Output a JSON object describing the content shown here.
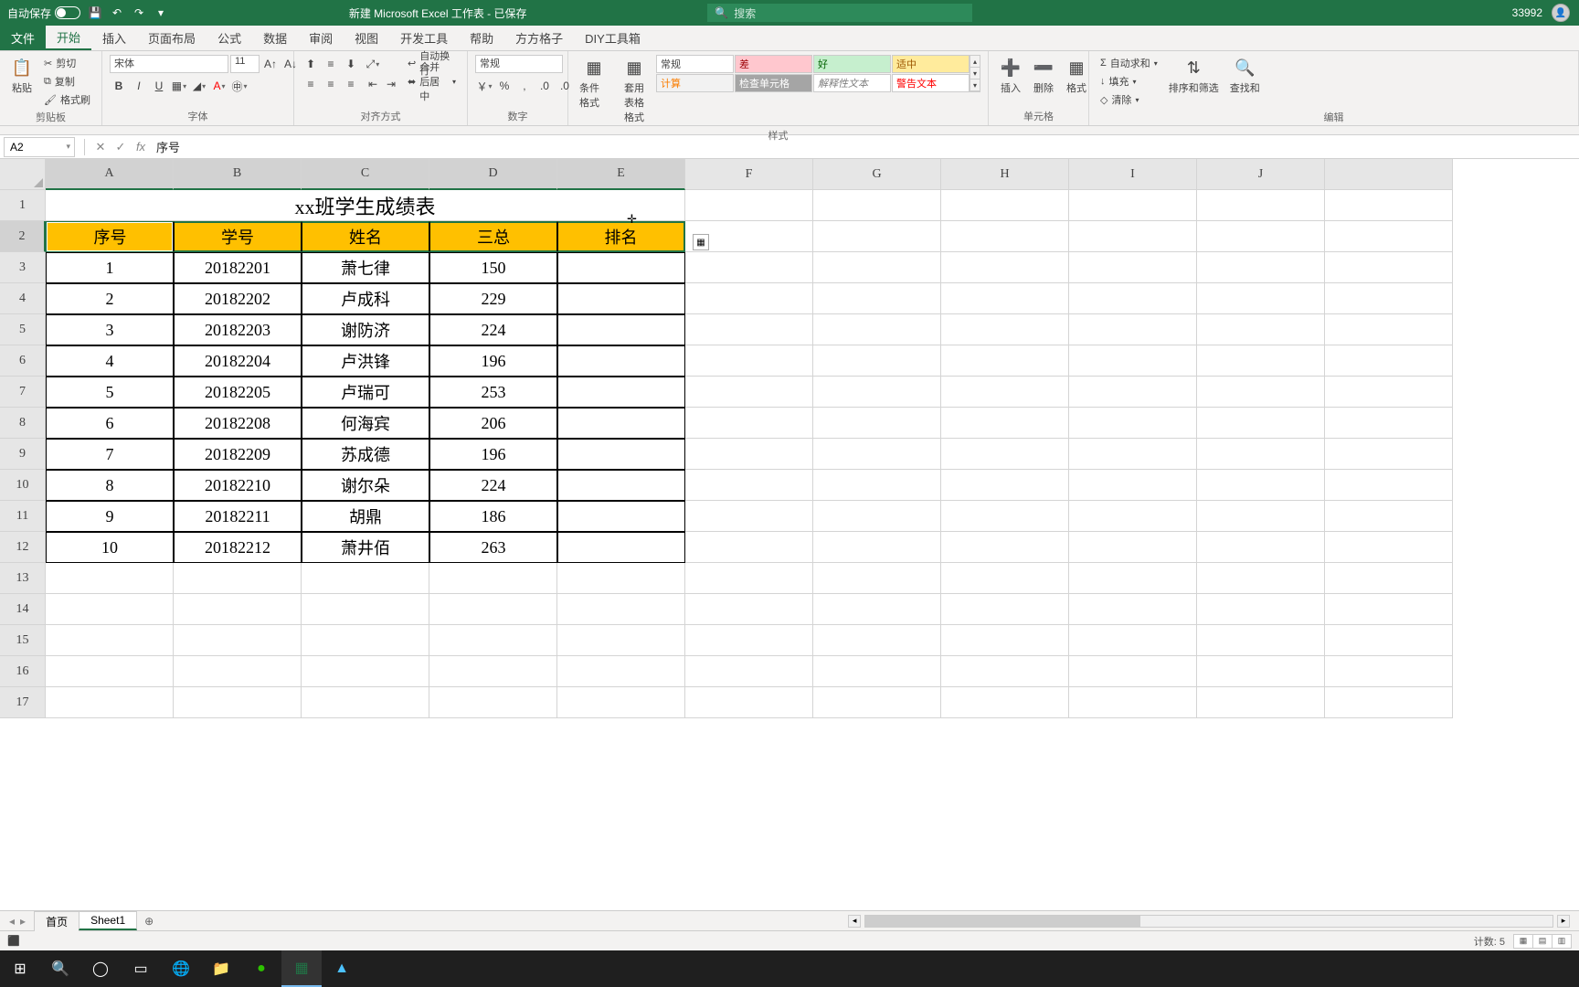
{
  "titlebar": {
    "autosave_label": "自动保存",
    "doc_title": "新建 Microsoft Excel 工作表 - 已保存",
    "search_placeholder": "搜索",
    "username": "33992"
  },
  "tabs": {
    "file": "文件",
    "home": "开始",
    "insert": "插入",
    "pagelayout": "页面布局",
    "formulas": "公式",
    "data": "数据",
    "review": "审阅",
    "view": "视图",
    "developer": "开发工具",
    "help": "帮助",
    "fangfang": "方方格子",
    "diy": "DIY工具箱"
  },
  "ribbon": {
    "clipboard": {
      "paste": "粘贴",
      "cut": "剪切",
      "copy": "复制",
      "format_painter": "格式刷",
      "label": "剪贴板"
    },
    "font": {
      "name": "宋体",
      "size": "11",
      "label": "字体"
    },
    "alignment": {
      "wrap": "自动换行",
      "merge": "合并后居中",
      "label": "对齐方式"
    },
    "number": {
      "format": "常规",
      "label": "数字"
    },
    "styles": {
      "cond": "条件格式",
      "table": "套用\n表格格式",
      "normal": "常规",
      "bad": "差",
      "good": "好",
      "neutral": "适中",
      "calc": "计算",
      "check": "检查单元格",
      "explain": "解释性文本",
      "warn": "警告文本",
      "label": "样式"
    },
    "cells": {
      "insert": "插入",
      "delete": "删除",
      "format": "格式",
      "label": "单元格"
    },
    "editing": {
      "autosum": "自动求和",
      "fill": "填充",
      "clear": "清除",
      "sort": "排序和筛选",
      "find": "查找和",
      "label": "编辑"
    }
  },
  "namebox": "A2",
  "formula_value": "序号",
  "columns": [
    "A",
    "B",
    "C",
    "D",
    "E",
    "F",
    "G",
    "H",
    "I",
    "J"
  ],
  "rows": [
    "1",
    "2",
    "3",
    "4",
    "5",
    "6",
    "7",
    "8",
    "9",
    "10",
    "11",
    "12",
    "13",
    "14",
    "15",
    "16",
    "17"
  ],
  "sheet": {
    "title": "xx班学生成绩表",
    "headers": [
      "序号",
      "学号",
      "姓名",
      "三总",
      "排名"
    ],
    "data": [
      [
        "1",
        "20182201",
        "萧七律",
        "150",
        ""
      ],
      [
        "2",
        "20182202",
        "卢成科",
        "229",
        ""
      ],
      [
        "3",
        "20182203",
        "谢防济",
        "224",
        ""
      ],
      [
        "4",
        "20182204",
        "卢洪锋",
        "196",
        ""
      ],
      [
        "5",
        "20182205",
        "卢瑞可",
        "253",
        ""
      ],
      [
        "6",
        "20182208",
        "何海宾",
        "206",
        ""
      ],
      [
        "7",
        "20182209",
        "苏成德",
        "196",
        ""
      ],
      [
        "8",
        "20182210",
        "谢尔朵",
        "224",
        ""
      ],
      [
        "9",
        "20182211",
        "胡鼎",
        "186",
        ""
      ],
      [
        "10",
        "20182212",
        "萧井佰",
        "263",
        ""
      ]
    ]
  },
  "sheet_tabs": {
    "home": "首页",
    "sheet1": "Sheet1"
  },
  "statusbar": {
    "count_label": "计数: 5"
  },
  "chart_data": {
    "type": "table",
    "title": "xx班学生成绩表",
    "columns": [
      "序号",
      "学号",
      "姓名",
      "三总",
      "排名"
    ],
    "rows": [
      [
        1,
        20182201,
        "萧七律",
        150,
        null
      ],
      [
        2,
        20182202,
        "卢成科",
        229,
        null
      ],
      [
        3,
        20182203,
        "谢防济",
        224,
        null
      ],
      [
        4,
        20182204,
        "卢洪锋",
        196,
        null
      ],
      [
        5,
        20182205,
        "卢瑞可",
        253,
        null
      ],
      [
        6,
        20182208,
        "何海宾",
        206,
        null
      ],
      [
        7,
        20182209,
        "苏成德",
        196,
        null
      ],
      [
        8,
        20182210,
        "谢尔朵",
        224,
        null
      ],
      [
        9,
        20182211,
        "胡鼎",
        186,
        null
      ],
      [
        10,
        20182212,
        "萧井佰",
        263,
        null
      ]
    ]
  }
}
